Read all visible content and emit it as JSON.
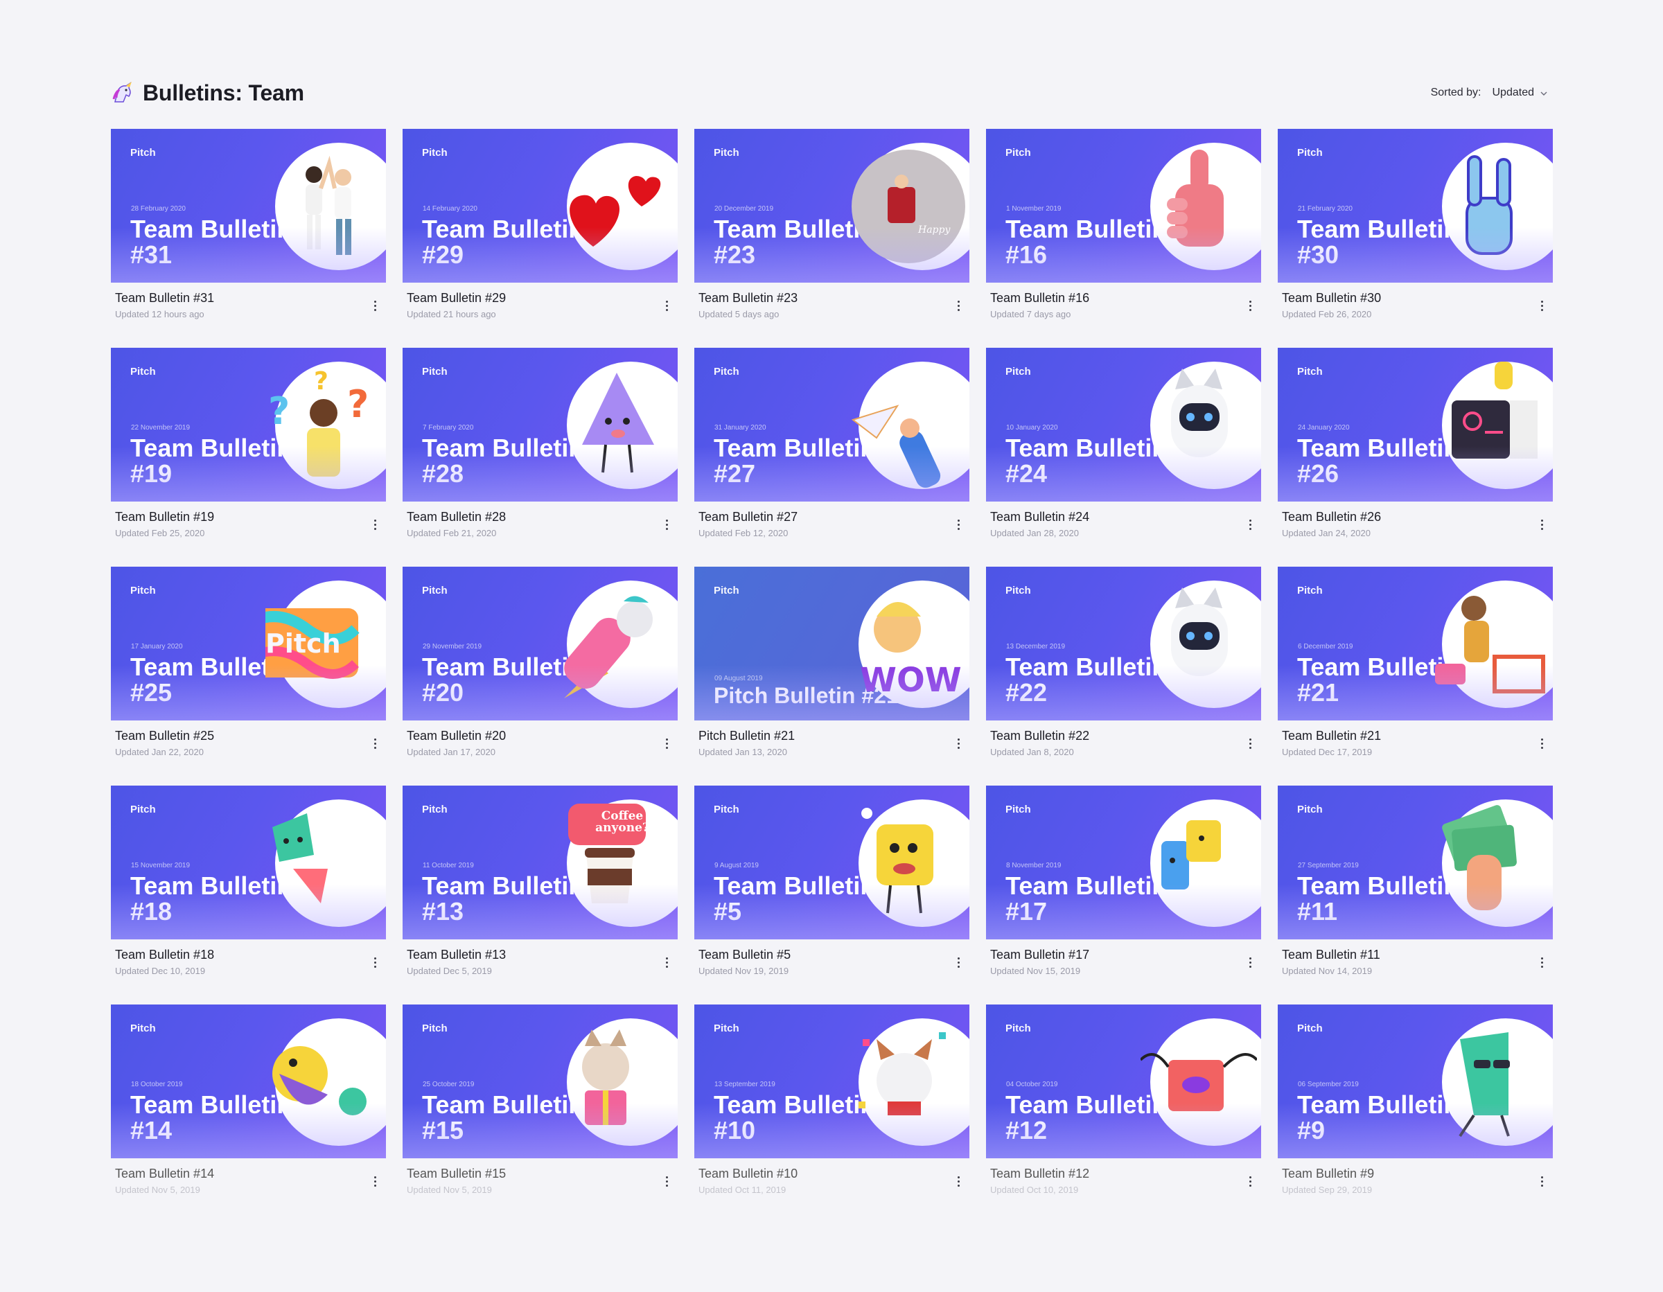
{
  "header": {
    "title": "Bulletins: Team",
    "icon": "unicorn-icon",
    "sort_label": "Sorted by:",
    "sort_value": "Updated"
  },
  "colors": {
    "thumb_gradient_start": "#4d55e6",
    "thumb_gradient_end": "#7b55f4",
    "background": "#f4f4f8"
  },
  "cards": [
    {
      "brand": "Pitch",
      "date": "28 February 2020",
      "thumb_title": "Team Bulletin #31",
      "name": "Team Bulletin #31",
      "updated": "Updated 12 hours ago",
      "art": "high-five-people-icon"
    },
    {
      "brand": "Pitch",
      "date": "14 February 2020",
      "thumb_title": "Team Bulletin #29",
      "name": "Team Bulletin #29",
      "updated": "Updated 21 hours ago",
      "art": "hearts-icon"
    },
    {
      "brand": "Pitch",
      "date": "20 December 2019",
      "thumb_title": "Team Bulletin #23",
      "name": "Team Bulletin #23",
      "updated": "Updated 5 days ago",
      "art": "happy-holidays-ornament-icon"
    },
    {
      "brand": "Pitch",
      "date": "1 November 2019",
      "thumb_title": "Team Bulletin #16",
      "name": "Team Bulletin #16",
      "updated": "Updated 7 days ago",
      "art": "foam-finger-icon"
    },
    {
      "brand": "Pitch",
      "date": "21 February 2020",
      "thumb_title": "Team Bulletin #30",
      "name": "Team Bulletin #30",
      "updated": "Updated Feb 26, 2020",
      "art": "rock-hand-icon"
    },
    {
      "brand": "Pitch",
      "date": "22 November 2019",
      "thumb_title": "Team Bulletin #19",
      "name": "Team Bulletin #19",
      "updated": "Updated Feb 25, 2020",
      "art": "question-marks-man-icon"
    },
    {
      "brand": "Pitch",
      "date": "7 February 2020",
      "thumb_title": "Team Bulletin #28",
      "name": "Team Bulletin #28",
      "updated": "Updated Feb 21, 2020",
      "art": "triangle-character-icon"
    },
    {
      "brand": "Pitch",
      "date": "31 January 2020",
      "thumb_title": "Team Bulletin #27",
      "name": "Team Bulletin #27",
      "updated": "Updated Feb 12, 2020",
      "art": "paper-plane-hand-icon"
    },
    {
      "brand": "Pitch",
      "date": "10 January 2020",
      "thumb_title": "Team Bulletin #24",
      "name": "Team Bulletin #24",
      "updated": "Updated Jan 28, 2020",
      "art": "robot-cat-icon"
    },
    {
      "brand": "Pitch",
      "date": "24 January 2020",
      "thumb_title": "Team Bulletin #26",
      "name": "Team Bulletin #26",
      "updated": "Updated Jan 24, 2020",
      "art": "speaker-box-icon"
    },
    {
      "brand": "Pitch",
      "date": "17 January 2020",
      "thumb_title": "Team Bulletin #25",
      "name": "Team Bulletin #25",
      "updated": "Updated Jan 22, 2020",
      "art": "pitch-clay-logo-icon"
    },
    {
      "brand": "Pitch",
      "date": "29 November 2019",
      "thumb_title": "Team Bulletin #20",
      "name": "Team Bulletin #20",
      "updated": "Updated Jan 17, 2020",
      "art": "rocket-dog-icon"
    },
    {
      "brand": "Pitch",
      "date": "09 August 2019",
      "thumb_title": "Pitch Bulletin #21",
      "name": "Pitch Bulletin #21",
      "updated": "Updated Jan 13, 2020",
      "art": "wow-face-icon",
      "alt": true
    },
    {
      "brand": "Pitch",
      "date": "13 December 2019",
      "thumb_title": "Team Bulletin #22",
      "name": "Team Bulletin #22",
      "updated": "Updated Jan 8, 2020",
      "art": "robot-cat-icon"
    },
    {
      "brand": "Pitch",
      "date": "6 December 2019",
      "thumb_title": "Team Bulletin #21",
      "name": "Team Bulletin #21",
      "updated": "Updated Dec 17, 2019",
      "art": "man-on-chair-icon"
    },
    {
      "brand": "Pitch",
      "date": "15 November 2019",
      "thumb_title": "Team Bulletin #18",
      "name": "Team Bulletin #18",
      "updated": "Updated Dec 10, 2019",
      "art": "shapes-characters-icon"
    },
    {
      "brand": "Pitch",
      "date": "11 October 2019",
      "thumb_title": "Team Bulletin #13",
      "name": "Team Bulletin #13",
      "updated": "Updated Dec 5, 2019",
      "art": "coffee-cup-icon",
      "bubble": "Coffee anyone?"
    },
    {
      "brand": "Pitch",
      "date": "9 August 2019",
      "thumb_title": "Team Bulletin #5",
      "name": "Team Bulletin #5",
      "updated": "Updated Nov 19, 2019",
      "art": "cheese-character-icon"
    },
    {
      "brand": "Pitch",
      "date": "8 November 2019",
      "thumb_title": "Team Bulletin #17",
      "name": "Team Bulletin #17",
      "updated": "Updated Nov 15, 2019",
      "art": "box-characters-icon"
    },
    {
      "brand": "Pitch",
      "date": "27 September 2019",
      "thumb_title": "Team Bulletin #11",
      "name": "Team Bulletin #11",
      "updated": "Updated Nov 14, 2019",
      "art": "money-hand-icon"
    },
    {
      "brand": "Pitch",
      "date": "18 October 2019",
      "thumb_title": "Team Bulletin #14",
      "name": "Team Bulletin #14",
      "updated": "Updated Nov 5, 2019",
      "art": "monsters-icon",
      "dim": true
    },
    {
      "brand": "Pitch",
      "date": "25 October 2019",
      "thumb_title": "Team Bulletin #15",
      "name": "Team Bulletin #15",
      "updated": "Updated Nov 5, 2019",
      "art": "dog-gift-icon",
      "dim": true
    },
    {
      "brand": "Pitch",
      "date": "13 September 2019",
      "thumb_title": "Team Bulletin #10",
      "name": "Team Bulletin #10",
      "updated": "Updated Oct 11, 2019",
      "art": "party-dog-icon",
      "dim": true
    },
    {
      "brand": "Pitch",
      "date": "04 October 2019",
      "thumb_title": "Team Bulletin #12",
      "name": "Team Bulletin #12",
      "updated": "Updated Oct 10, 2019",
      "art": "red-box-character-icon",
      "dim": true
    },
    {
      "brand": "Pitch",
      "date": "06 September 2019",
      "thumb_title": "Team Bulletin #9",
      "name": "Team Bulletin #9",
      "updated": "Updated Sep 29, 2019",
      "art": "green-shape-sunglasses-icon",
      "dim": true
    }
  ]
}
